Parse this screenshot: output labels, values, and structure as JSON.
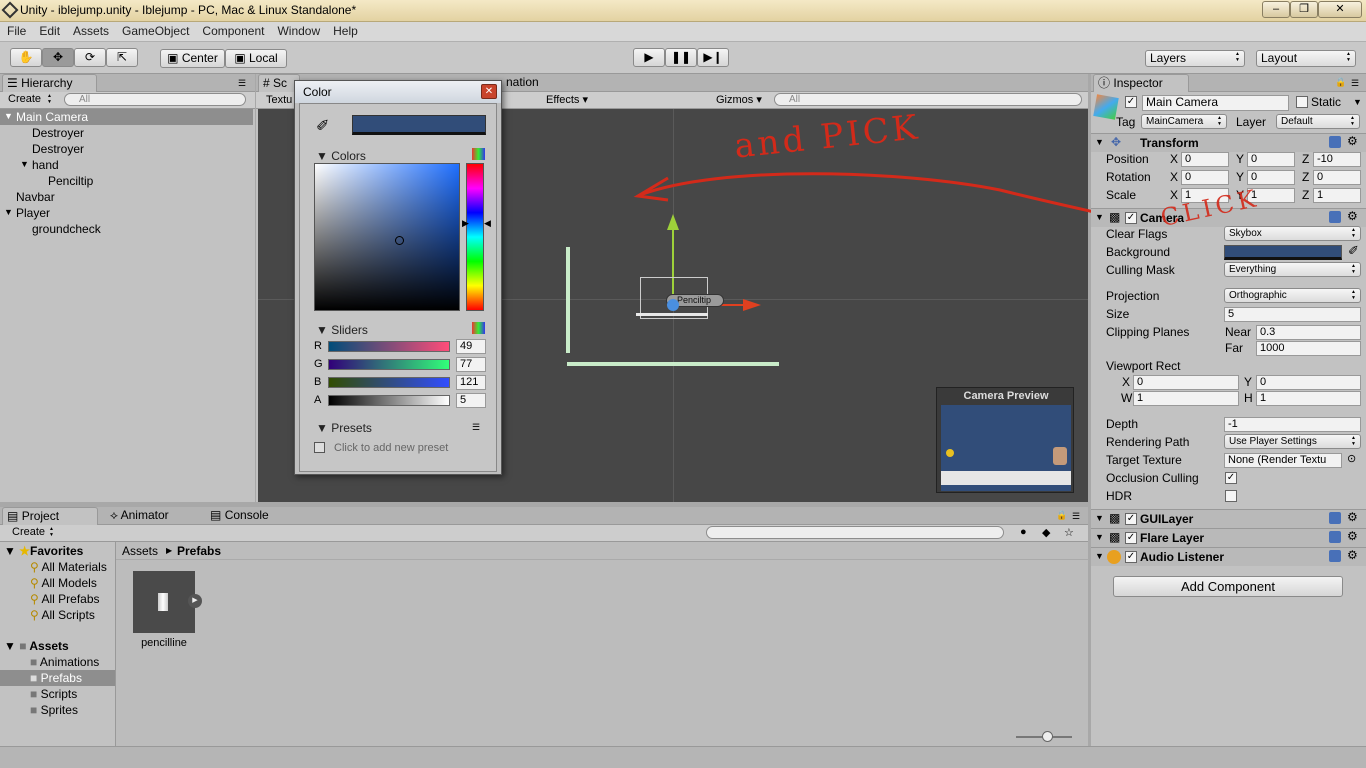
{
  "window": {
    "title": "Unity - iblejump.unity - Iblejump - PC, Mac & Linux Standalone*"
  },
  "menu": [
    "File",
    "Edit",
    "Assets",
    "GameObject",
    "Component",
    "Window",
    "Help"
  ],
  "toolbar": {
    "center": "Center",
    "local": "Local",
    "layers": "Layers",
    "layout": "Layout"
  },
  "hierarchy": {
    "tab": "Hierarchy",
    "create": "Create",
    "search_placeholder": "All",
    "items": [
      {
        "label": "Main Camera"
      },
      {
        "label": "Destroyer"
      },
      {
        "label": "Destroyer"
      },
      {
        "label": "hand"
      },
      {
        "label": "Penciltip"
      },
      {
        "label": "Navbar"
      },
      {
        "label": "Player"
      },
      {
        "label": "groundcheck"
      }
    ]
  },
  "scene": {
    "tab_scene": "Sc",
    "tab_animation": "nation",
    "textured": "Textu",
    "effects": "Effects",
    "gizmos": "Gizmos",
    "search_placeholder": "All",
    "object_label": "Penciltip",
    "preview_title": "Camera Preview",
    "annotation_pick": "and PICK",
    "annotation_click": "CLICK"
  },
  "color_picker": {
    "title": "Color",
    "colors_label": "Colors",
    "sliders_label": "Sliders",
    "channels": [
      {
        "name": "R",
        "value": "49"
      },
      {
        "name": "G",
        "value": "77"
      },
      {
        "name": "B",
        "value": "121"
      },
      {
        "name": "A",
        "value": "5"
      }
    ],
    "presets_label": "Presets",
    "add_preset": "Click to add new preset",
    "current_color": "#314d79"
  },
  "project": {
    "tab_project": "Project",
    "tab_animator": "Animator",
    "tab_console": "Console",
    "create": "Create",
    "favorites_label": "Favorites",
    "favorites": [
      "All Materials",
      "All Models",
      "All Prefabs",
      "All Scripts"
    ],
    "assets_label": "Assets",
    "folders": [
      "Animations",
      "Prefabs",
      "Scripts",
      "Sprites"
    ],
    "breadcrumb_root": "Assets",
    "breadcrumb_current": "Prefabs",
    "asset_name": "pencilline"
  },
  "inspector": {
    "tab": "Inspector",
    "object_name": "Main Camera",
    "static": "Static",
    "tag_label": "Tag",
    "tag": "MainCamera",
    "layer_label": "Layer",
    "layer": "Default",
    "transform": {
      "title": "Transform",
      "rows": [
        {
          "label": "Position",
          "x": "0",
          "y": "0",
          "z": "-10"
        },
        {
          "label": "Rotation",
          "x": "0",
          "y": "0",
          "z": "0"
        },
        {
          "label": "Scale",
          "x": "1",
          "y": "1",
          "z": "1"
        }
      ]
    },
    "camera": {
      "title": "Camera",
      "clear_flags_label": "Clear Flags",
      "clear_flags": "Skybox",
      "background_label": "Background",
      "culling_label": "Culling Mask",
      "culling": "Everything",
      "projection_label": "Projection",
      "projection": "Orthographic",
      "size_label": "Size",
      "size": "5",
      "clipping_label": "Clipping Planes",
      "near_label": "Near",
      "near": "0.3",
      "far_label": "Far",
      "far": "1000",
      "viewport_label": "Viewport Rect",
      "vx": "0",
      "vy": "0",
      "vw": "1",
      "vh": "1",
      "depth_label": "Depth",
      "depth": "-1",
      "rendering_label": "Rendering Path",
      "rendering": "Use Player Settings",
      "target_label": "Target Texture",
      "target": "None (Render Textu",
      "occlusion_label": "Occlusion Culling",
      "hdr_label": "HDR"
    },
    "components": [
      "GUILayer",
      "Flare Layer",
      "Audio Listener"
    ],
    "add_component": "Add Component"
  }
}
